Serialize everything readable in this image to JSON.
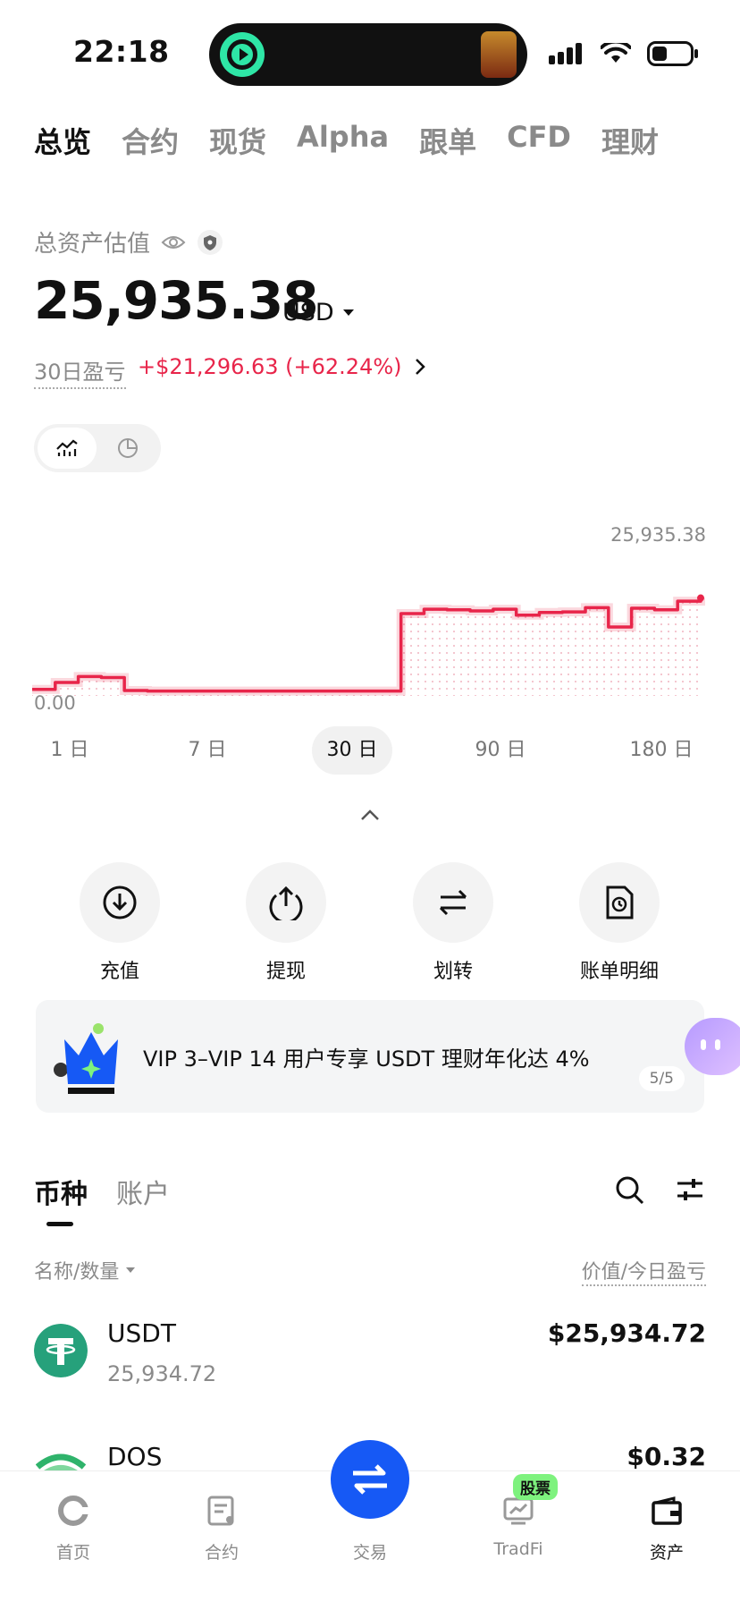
{
  "status_bar": {
    "time": "22:18"
  },
  "top_tabs": [
    "总览",
    "合约",
    "现货",
    "Alpha",
    "跟单",
    "CFD",
    "理财"
  ],
  "summary": {
    "label": "总资产估值",
    "total": "25,935.38",
    "currency": "USD",
    "pnl_label": "30日盈亏",
    "pnl_value": "+$21,296.63 (+62.24%)"
  },
  "chart": {
    "max_label": "25,935.38",
    "min_label": "0.00",
    "line_color": "#e8254a"
  },
  "chart_data": {
    "type": "line",
    "x": [
      "d1",
      "d2",
      "d3",
      "d4",
      "d5",
      "d6",
      "d7",
      "d8",
      "d9",
      "d10",
      "d11",
      "d12",
      "d13",
      "d14",
      "d15",
      "d16",
      "d17",
      "d18",
      "d19",
      "d20",
      "d21",
      "d22",
      "d23",
      "d24",
      "d25",
      "d26",
      "d27",
      "d28",
      "d29",
      "d30"
    ],
    "series": [
      {
        "values": [
          1200,
          2500,
          3600,
          3400,
          1000,
          900,
          900,
          900,
          900,
          900,
          900,
          900,
          900,
          900,
          900,
          900,
          15300,
          16100,
          16000,
          15800,
          16100,
          15000,
          15500,
          15600,
          16400,
          12800,
          16300,
          16000,
          17600,
          18200
        ]
      }
    ],
    "ylim": [
      0,
      25935.38
    ]
  },
  "ranges": [
    {
      "label": "1 日",
      "active": false
    },
    {
      "label": "7 日",
      "active": false
    },
    {
      "label": "30 日",
      "active": true
    },
    {
      "label": "90 日",
      "active": false
    },
    {
      "label": "180 日",
      "active": false
    }
  ],
  "actions": [
    {
      "label": "充值",
      "icon": "deposit-icon"
    },
    {
      "label": "提现",
      "icon": "withdraw-icon"
    },
    {
      "label": "划转",
      "icon": "transfer-icon"
    },
    {
      "label": "账单明细",
      "icon": "bill-icon"
    }
  ],
  "banner": {
    "text": "VIP 3–VIP 14 用户专享 USDT 理财年化达 4%",
    "page": "5/5"
  },
  "asset_tabs": [
    "币种",
    "账户"
  ],
  "list_header": {
    "left": "名称/数量",
    "right": "价值/今日盈亏"
  },
  "coins": [
    {
      "name": "USDT",
      "qty": "25,934.72",
      "value": "$25,934.72"
    },
    {
      "name": "DOS",
      "qty": "",
      "value": "$0.32"
    }
  ],
  "bottom_nav": [
    {
      "label": "首页",
      "icon": "home-icon"
    },
    {
      "label": "合约",
      "icon": "contract-icon"
    },
    {
      "label": "交易",
      "icon": "trade-icon"
    },
    {
      "label": "TradFi",
      "icon": "tradfi-icon",
      "badge": "股票"
    },
    {
      "label": "资产",
      "icon": "wallet-icon"
    }
  ]
}
